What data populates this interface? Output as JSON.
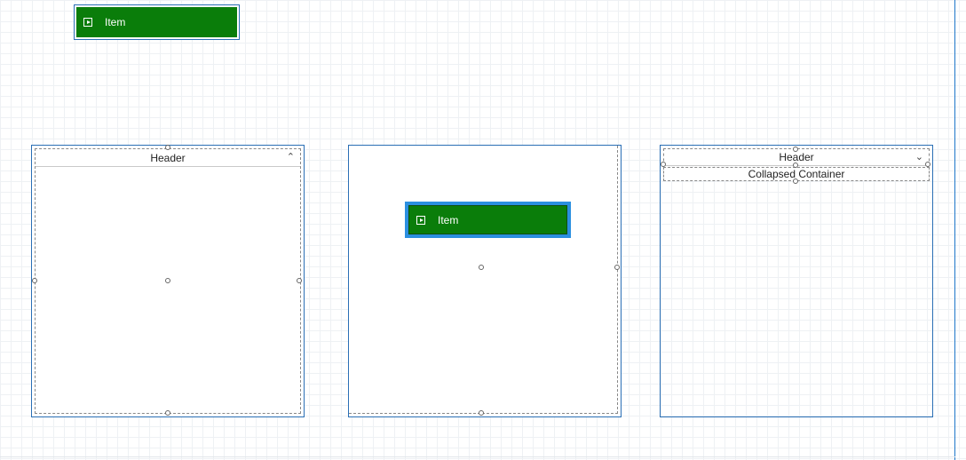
{
  "top_item": {
    "label": "Item",
    "icon": "play-square-icon",
    "color": "#0a7d0a"
  },
  "panel_left": {
    "header": "Header",
    "expanded": true
  },
  "panel_middle": {
    "item_label": "Item",
    "item_selected": true,
    "item_color": "#0a7d0a"
  },
  "panel_right": {
    "header": "Header",
    "collapsed_label": "Collapsed Container",
    "expanded": false
  },
  "colors": {
    "accent": "#2a6fb5",
    "selection": "#2b8fe0",
    "item_green": "#0a7d0a"
  }
}
